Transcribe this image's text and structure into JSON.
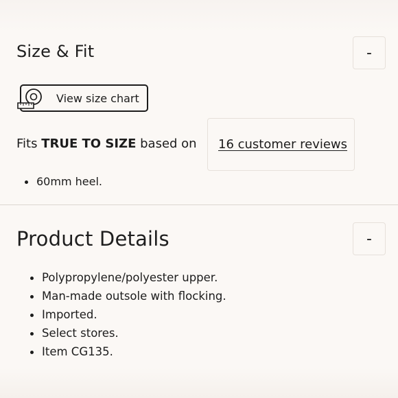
{
  "size_fit": {
    "title": "Size & Fit",
    "toggle_label": "-",
    "size_chart_button": "View size chart",
    "fits_prefix": "Fits ",
    "fits_value": "TRUE TO SIZE",
    "fits_suffix": " based on",
    "reviews_link": "16 customer reviews",
    "bullets": [
      "60mm heel."
    ]
  },
  "product_details": {
    "title": "Product Details",
    "toggle_label": "-",
    "bullets": [
      "Polypropylene/polyester upper.",
      "Man-made outsole with flocking.",
      "Imported.",
      "Select stores.",
      "Item CG135."
    ]
  },
  "icons": {
    "size_chart": "measuring-tape-icon"
  },
  "colors": {
    "background": "#fbf8f5",
    "text": "#1c1c1c",
    "border": "#e6e0da",
    "divider": "#dcd6d0"
  }
}
